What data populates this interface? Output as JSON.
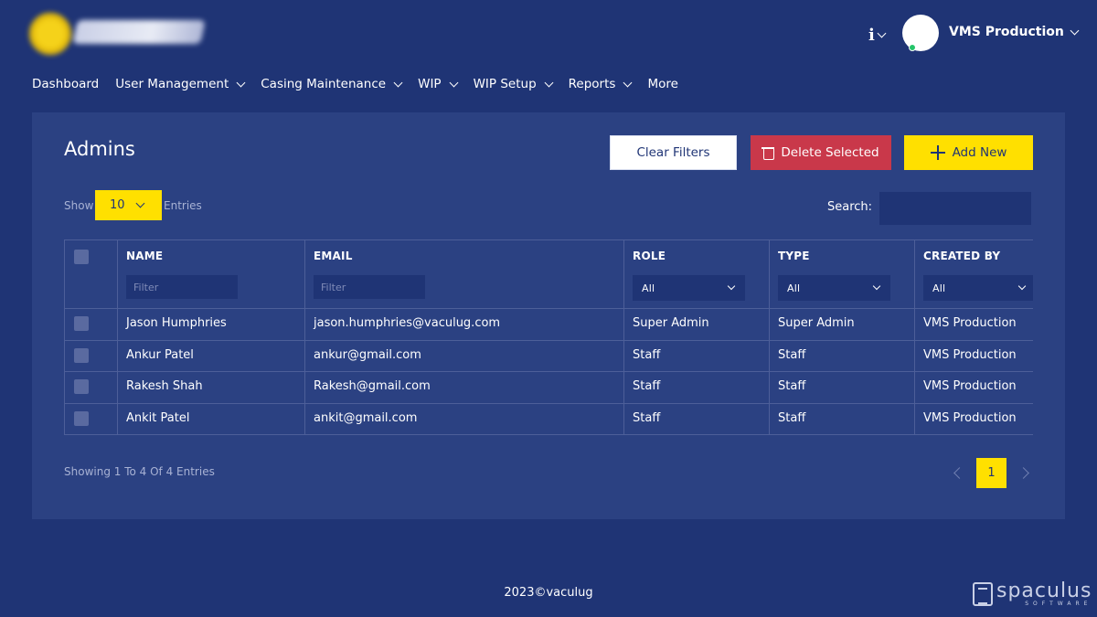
{
  "header": {
    "info_icon": "i",
    "user_name": "VMS Production"
  },
  "nav": [
    {
      "label": "Dashboard",
      "has_dropdown": false
    },
    {
      "label": "User Management",
      "has_dropdown": true
    },
    {
      "label": "Casing Maintenance",
      "has_dropdown": true
    },
    {
      "label": "WIP",
      "has_dropdown": true
    },
    {
      "label": "WIP Setup",
      "has_dropdown": true
    },
    {
      "label": "Reports",
      "has_dropdown": true
    },
    {
      "label": "More",
      "has_dropdown": false
    }
  ],
  "page": {
    "title": "Admins",
    "clear_filters": "Clear Filters",
    "delete_selected": "Delete Selected",
    "add_new": "Add New",
    "show_label": "Show",
    "show_value": "10",
    "entries_label": "Entries",
    "search_label": "Search:",
    "search_value": ""
  },
  "table": {
    "columns": [
      "NAME",
      "EMAIL",
      "ROLE",
      "TYPE",
      "CREATED BY"
    ],
    "filter_placeholder": "Filter",
    "select_all": "All",
    "rows": [
      [
        "Jason Humphries",
        "jason.humphries@vaculug.com",
        "Super Admin",
        "Super Admin",
        "VMS Production"
      ],
      [
        "Ankur Patel",
        "ankur@gmail.com",
        "Staff",
        "Staff",
        "VMS Production"
      ],
      [
        "Rakesh Shah",
        "Rakesh@gmail.com",
        "Staff",
        "Staff",
        "VMS Production"
      ],
      [
        "Ankit Patel",
        "ankit@gmail.com",
        "Staff",
        "Staff",
        "VMS Production"
      ]
    ]
  },
  "pagination": {
    "showing": "Showing 1 To 4 Of 4 Entries",
    "current_page": "1"
  },
  "footer": {
    "copyright": "2023©vaculug"
  },
  "brand": {
    "name": "spaculus",
    "sub": "SOFTWARE"
  },
  "colors": {
    "background": "#1f3475",
    "card": "#2b4182",
    "accent": "#ffe000",
    "danger": "#c9384a"
  }
}
